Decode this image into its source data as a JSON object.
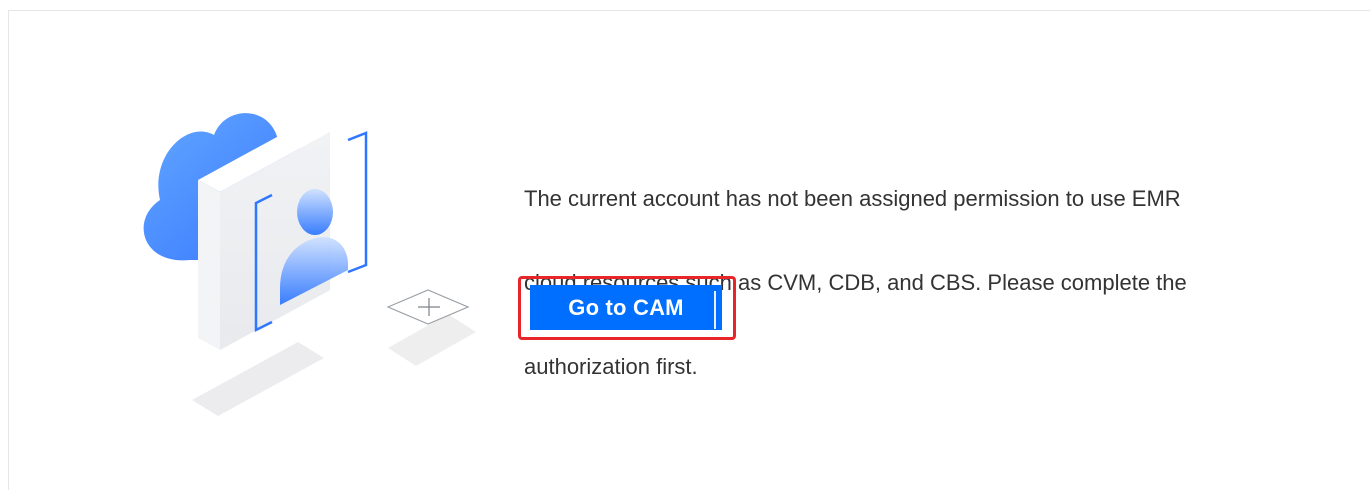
{
  "notice": {
    "lines": [
      "The current account has not been assigned permission to use EMR",
      "cloud resources such as CVM, CDB, and CBS. Please complete the",
      "authorization first."
    ]
  },
  "actions": {
    "go_to_cam_label": "Go to CAM"
  },
  "illustration": {
    "icon": "cloud-user-authorization-illustration"
  },
  "colors": {
    "primary": "#006eff",
    "highlight_border": "#e8262a",
    "text": "#333333"
  }
}
